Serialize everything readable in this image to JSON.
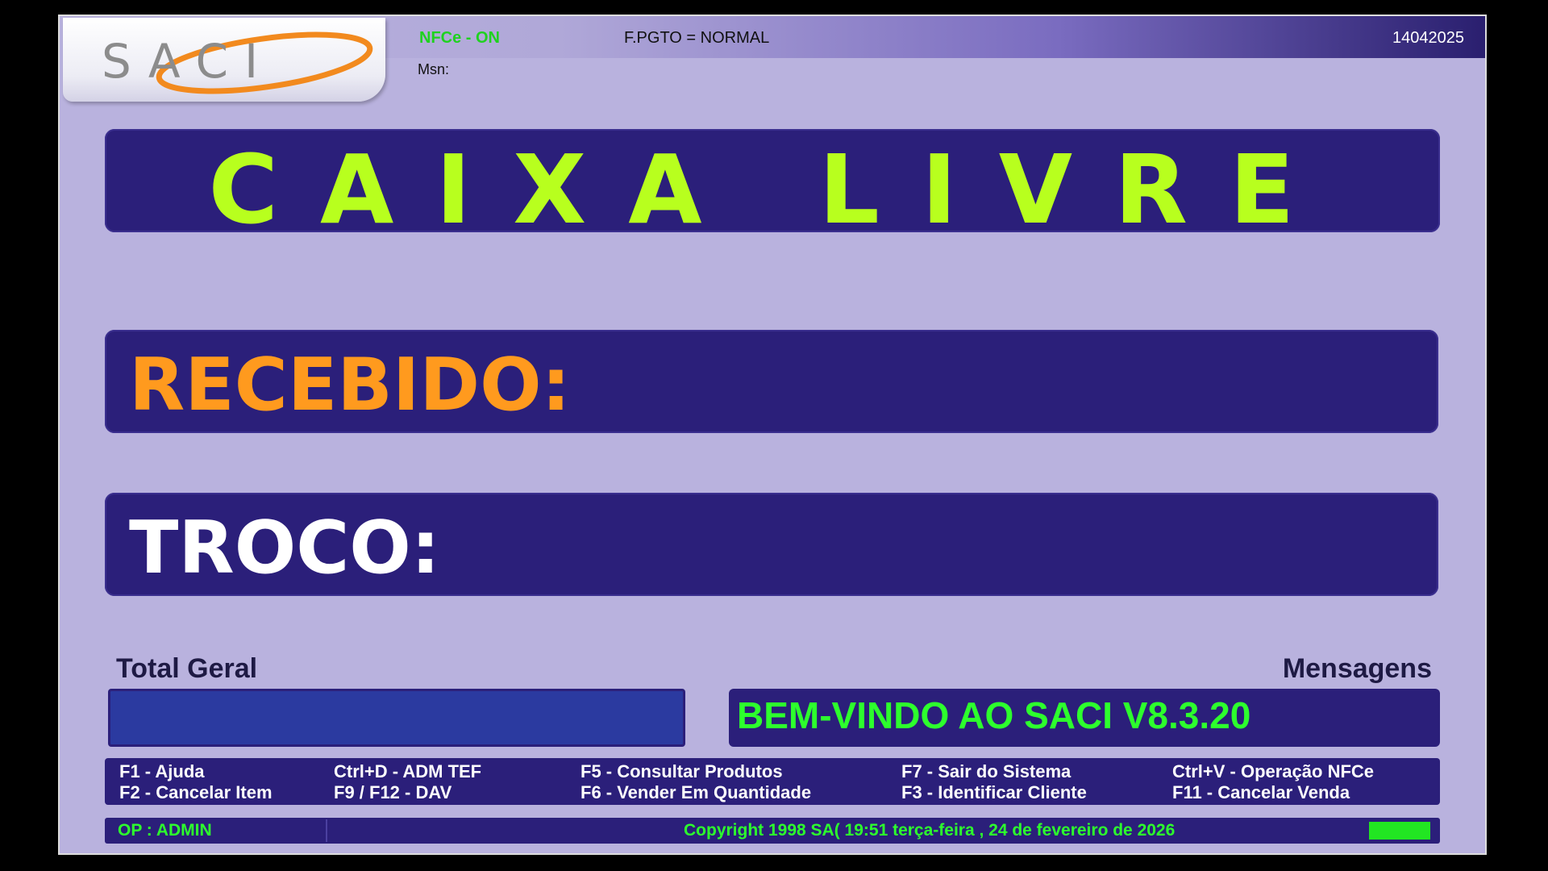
{
  "logo": {
    "text": "SACI"
  },
  "topbar": {
    "nfce_status": "NFCe - ON",
    "pgto_status": "F.PGTO = NORMAL",
    "code": "14042025",
    "msn_label": "Msn:"
  },
  "main": {
    "status_title": "CAIXA LIVRE",
    "recebido_label": "RECEBIDO:",
    "troco_label": "TROCO:"
  },
  "totals": {
    "label": "Total Geral",
    "value": ""
  },
  "messages": {
    "label": "Mensagens",
    "text": "BEM-VINDO AO SACI V8.3.20"
  },
  "shortcuts": [
    "F1 - Ajuda",
    "F2 - Cancelar Item",
    "Ctrl+D - ADM TEF",
    "F9 / F12 - DAV",
    "F5 - Consultar Produtos",
    "F6 - Vender Em Quantidade",
    "F7 - Sair do Sistema",
    "F3 - Identificar Cliente",
    "Ctrl+V - Operação NFCe",
    "F11 - Cancelar Venda"
  ],
  "statusbar": {
    "operator": "OP : ADMIN",
    "copyright": "Copyright 1998 SA( 19:51  terça-feira , 24  de  fevereiro  de  2026"
  },
  "colors": {
    "panel": "#2b1f7a",
    "background": "#b9b2de",
    "title_green": "#b8ff1e",
    "recebido_orange": "#ff9a1e",
    "message_green": "#2dff2d"
  }
}
